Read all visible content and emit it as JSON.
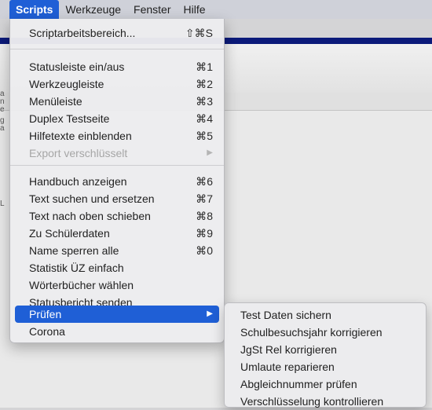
{
  "menubar": {
    "items": [
      {
        "label": "Scripts",
        "active": true
      },
      {
        "label": "Werkzeuge"
      },
      {
        "label": "Fenster"
      },
      {
        "label": "Hilfe"
      }
    ]
  },
  "scripts_menu": {
    "items": [
      {
        "label": "Scriptarbeitsbereich...",
        "shortcut": "⇧⌘S"
      },
      {
        "label": "Statusleiste ein/aus",
        "shortcut": "⌘1"
      },
      {
        "label": "Werkzeugleiste",
        "shortcut": "⌘2"
      },
      {
        "label": "Menüleiste",
        "shortcut": "⌘3"
      },
      {
        "label": "Duplex Testseite",
        "shortcut": "⌘4"
      },
      {
        "label": "Hilfetexte einblenden",
        "shortcut": "⌘5"
      },
      {
        "label": "Export verschlüsselt",
        "shortcut": "▶",
        "disabled": true
      },
      {
        "label": "Handbuch anzeigen",
        "shortcut": "⌘6"
      },
      {
        "label": "Text suchen und ersetzen",
        "shortcut": "⌘7"
      },
      {
        "label": "Text nach oben schieben",
        "shortcut": "⌘8"
      },
      {
        "label": "Zu Schülerdaten",
        "shortcut": "⌘9"
      },
      {
        "label": "Name sperren alle",
        "shortcut": "⌘0"
      },
      {
        "label": "Statistik ÜZ einfach",
        "shortcut": ""
      },
      {
        "label": "Wörterbücher wählen",
        "shortcut": ""
      },
      {
        "label": "Statusbericht senden",
        "shortcut": ""
      },
      {
        "label": "Prüfen",
        "shortcut": "▶",
        "highlighted": true
      },
      {
        "label": "Corona",
        "shortcut": ""
      }
    ]
  },
  "pruefen_submenu": {
    "items": [
      "Test Daten sichern",
      "Schulbesuchsjahr korrigieren",
      "JgSt Rel korrigieren",
      "Umlaute reparieren",
      "Abgleichnummer prüfen",
      "Verschlüsselung kontrollieren"
    ]
  },
  "background": {
    "edge_glyphs": [
      "a",
      "n",
      "e",
      "g",
      "a",
      "L"
    ]
  },
  "colors": {
    "accent": "#1f5fd6",
    "menubar": "#cfd1d9",
    "menu_bg": "#ececee",
    "title_strip": "#0b1a7a"
  }
}
